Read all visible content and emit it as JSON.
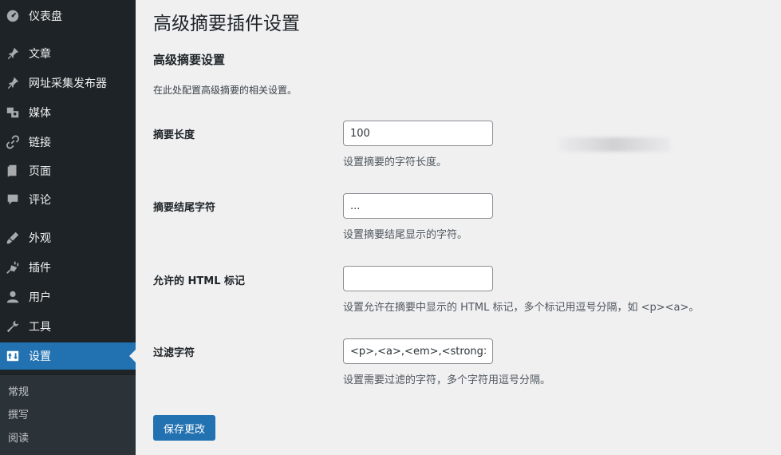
{
  "sidebar": {
    "items": [
      {
        "label": "仪表盘",
        "icon": "dashboard-icon"
      },
      {
        "label": "文章",
        "icon": "pin-icon"
      },
      {
        "label": "网址采集发布器",
        "icon": "pin-icon"
      },
      {
        "label": "媒体",
        "icon": "media-icon"
      },
      {
        "label": "链接",
        "icon": "link-icon"
      },
      {
        "label": "页面",
        "icon": "page-icon"
      },
      {
        "label": "评论",
        "icon": "comment-icon"
      },
      {
        "label": "外观",
        "icon": "appearance-icon"
      },
      {
        "label": "插件",
        "icon": "plugin-icon"
      },
      {
        "label": "用户",
        "icon": "user-icon"
      },
      {
        "label": "工具",
        "icon": "wrench-icon"
      },
      {
        "label": "设置",
        "icon": "settings-icon",
        "active": true
      }
    ],
    "submenu": [
      "常规",
      "撰写",
      "阅读"
    ],
    "colors": {
      "background": "#1d2327",
      "active": "#2271b1",
      "submenu": "#2c3338"
    }
  },
  "main": {
    "title": "高级摘要插件设置",
    "section_title": "高级摘要设置",
    "section_desc": "在此处配置高级摘要的相关设置。",
    "fields": [
      {
        "label": "摘要长度",
        "value": "100",
        "help": "设置摘要的字符长度。"
      },
      {
        "label": "摘要结尾字符",
        "value": "...",
        "help": "设置摘要结尾显示的字符。"
      },
      {
        "label": "允许的 HTML 标记",
        "value": "",
        "help": "设置允许在摘要中显示的 HTML 标记，多个标记用逗号分隔，如 <p><a>。"
      },
      {
        "label": "过滤字符",
        "value": "<p>,<a>,<em>,<strong>",
        "help": "设置需要过滤的字符，多个字符用逗号分隔。"
      }
    ],
    "save_label": "保存更改",
    "accent": "#2271b1"
  }
}
